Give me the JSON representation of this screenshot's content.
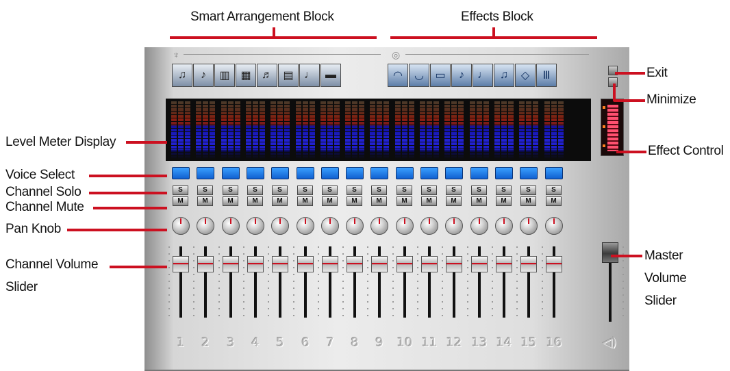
{
  "callouts": {
    "smart_arrangement": "Smart Arrangement Block",
    "effects": "Effects Block",
    "exit": "Exit",
    "minimize": "Minimize",
    "level_meter": "Level Meter Display",
    "effect_control": "Effect Control",
    "voice_select": "Voice Select",
    "channel_solo": "Channel Solo",
    "channel_mute": "Channel Mute",
    "pan_knob": "Pan Knob",
    "channel_volume_1": "Channel Volume",
    "channel_volume_2": "Slider",
    "master_volume_1": "Master",
    "master_volume_2": "Volume",
    "master_volume_3": "Slider"
  },
  "smart_arrangement_icons": [
    "piano-icon",
    "guitarist-icon",
    "organ-icon",
    "keyboard-icon",
    "drummer-icon",
    "speaker-icon",
    "strings-icon",
    "brass-icon"
  ],
  "smart_arrangement_glyphs": [
    "♫",
    "♪",
    "▥",
    "▦",
    "♬",
    "▤",
    "♩",
    "▬"
  ],
  "effects_icons": [
    "hall-icon",
    "room-icon",
    "stage-icon",
    "chorus-icon",
    "flanger-icon",
    "delay-icon",
    "rotary-icon",
    "eq-icon"
  ],
  "effects_glyphs": [
    "◠",
    "◡",
    "▭",
    "♪",
    "♩",
    "♫",
    "◇",
    "Ⅲ"
  ],
  "solo_label": "S",
  "mute_label": "M",
  "channel_numbers": [
    "1",
    "2",
    "3",
    "4",
    "5",
    "6",
    "7",
    "8",
    "9",
    "10",
    "11",
    "12",
    "13",
    "14",
    "15",
    "16"
  ],
  "master_glyph": "◁)",
  "accent_color": "#cc1020"
}
